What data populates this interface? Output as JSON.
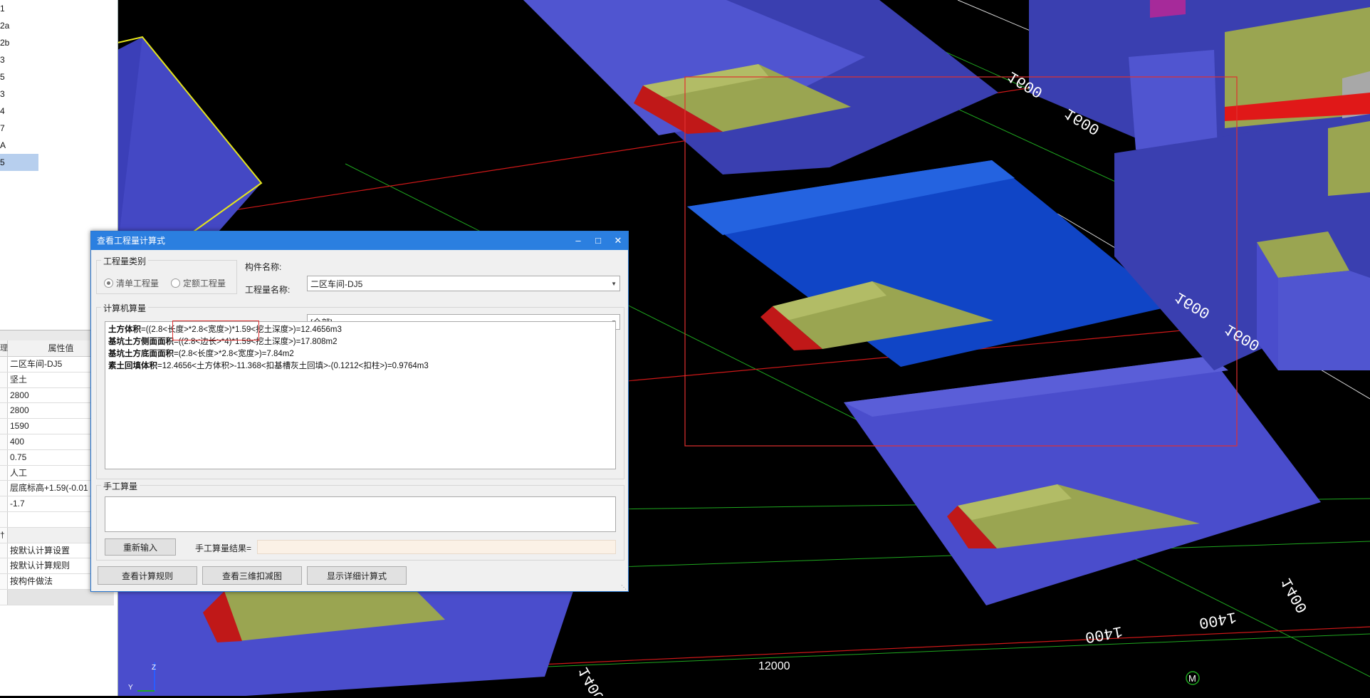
{
  "tree": {
    "items": [
      {
        "label": "1"
      },
      {
        "label": "2a"
      },
      {
        "label": "2b"
      },
      {
        "label": "3"
      },
      {
        "label": "5"
      },
      {
        "label": "3"
      },
      {
        "label": "4"
      },
      {
        "label": "7"
      },
      {
        "label": "A"
      },
      {
        "label": "5",
        "selected": true
      }
    ]
  },
  "properties": {
    "col_left": "理",
    "col_value": "属性值",
    "rows": [
      {
        "value": "二区车间-DJ5"
      },
      {
        "value": "坚土"
      },
      {
        "value": "2800"
      },
      {
        "value": "2800"
      },
      {
        "value": "1590"
      },
      {
        "value": "400"
      },
      {
        "value": "0.75"
      },
      {
        "value": "人工"
      },
      {
        "value": "层底标高+1.59(-0.01"
      },
      {
        "value": "-1.7"
      },
      {
        "value": ""
      }
    ],
    "group_left": "†",
    "settings": [
      {
        "value": "按默认计算设置"
      },
      {
        "value": "按默认计算规则"
      },
      {
        "value": "按构件做法"
      }
    ]
  },
  "dialog": {
    "title": "查看工程量计算式",
    "quantity_type_label": "工程量类别",
    "radio_list": "清单工程量",
    "radio_quota": "定额工程量",
    "component_name_label": "构件名称:",
    "component_name_value": "二区车间-DJ5",
    "quantity_name_label": "工程量名称:",
    "quantity_name_value": "[全部]",
    "computer_section": "计算机算量",
    "formulas": [
      {
        "name": "土方体积",
        "expr": "=((2.8<长度>*2.8<宽度>)*1.59<挖土深度>)=12.4656m3"
      },
      {
        "name": "基坑土方侧面面积",
        "expr": "=((2.8<边长>*4)*1.59<挖土深度>)=17.808m2"
      },
      {
        "name": "基坑土方底面面积",
        "expr": "=(2.8<长度>*2.8<宽度>)=7.84m2"
      },
      {
        "name": "素土回填体积",
        "expr": "=12.4656<土方体积>-11.368<扣基槽灰土回填>-(0.1212<扣柱>)=0.9764m3"
      }
    ],
    "manual_section": "手工算量",
    "reinput_button": "重新输入",
    "manual_result_label": "手工算量结果=",
    "btn_rules": "查看计算规则",
    "btn_3d": "查看三维扣减图",
    "btn_detail": "显示详细计算式"
  },
  "scene": {
    "dims": [
      "1600",
      "1600",
      "1600",
      "1600",
      "1400",
      "1400",
      "1400",
      "1400",
      "12000",
      "1600"
    ],
    "axis_label": "M",
    "axis_z": "Z",
    "axis_y": "Y",
    "colors": {
      "background": "#000000",
      "pit_purple": "#4a4dcc",
      "pit_selected": "#1045c6",
      "footing_olive": "#9aa551",
      "grid_red": "#d01818",
      "grid_green": "#1fa81f",
      "selection_rect": "#e03030"
    }
  }
}
